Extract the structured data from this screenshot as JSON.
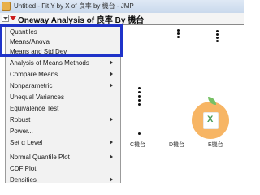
{
  "window": {
    "title": "Untitled - Fit Y by X of 良率 by 機台 - JMP"
  },
  "report": {
    "title": "Oneway Analysis of 良率 By 機台"
  },
  "menu": {
    "items": [
      {
        "label": "Quantiles",
        "submenu": false
      },
      {
        "label": "Means/Anova",
        "submenu": false
      },
      {
        "label": "Means and Std Dev",
        "submenu": false
      },
      {
        "label": "Analysis of Means Methods",
        "submenu": true
      },
      {
        "label": "Compare Means",
        "submenu": true
      },
      {
        "label": "Nonparametric",
        "submenu": true
      },
      {
        "label": "Unequal Variances",
        "submenu": false
      },
      {
        "label": "Equivalence Test",
        "submenu": false
      },
      {
        "label": "Robust",
        "submenu": true
      },
      {
        "label": "Power...",
        "submenu": false
      },
      {
        "label": "Set α Level",
        "submenu": true
      },
      {
        "label": "Normal Quantile Plot",
        "submenu": true
      },
      {
        "label": "CDF Plot",
        "submenu": false
      },
      {
        "label": "Densities",
        "submenu": true
      }
    ]
  },
  "plot": {
    "x_labels": [
      "C機台",
      "D機台",
      "E機台"
    ]
  },
  "watermark": {
    "glyph": "X"
  },
  "colors": {
    "highlight": "#1f33c9",
    "red_triangle": "#cc1d1d"
  }
}
